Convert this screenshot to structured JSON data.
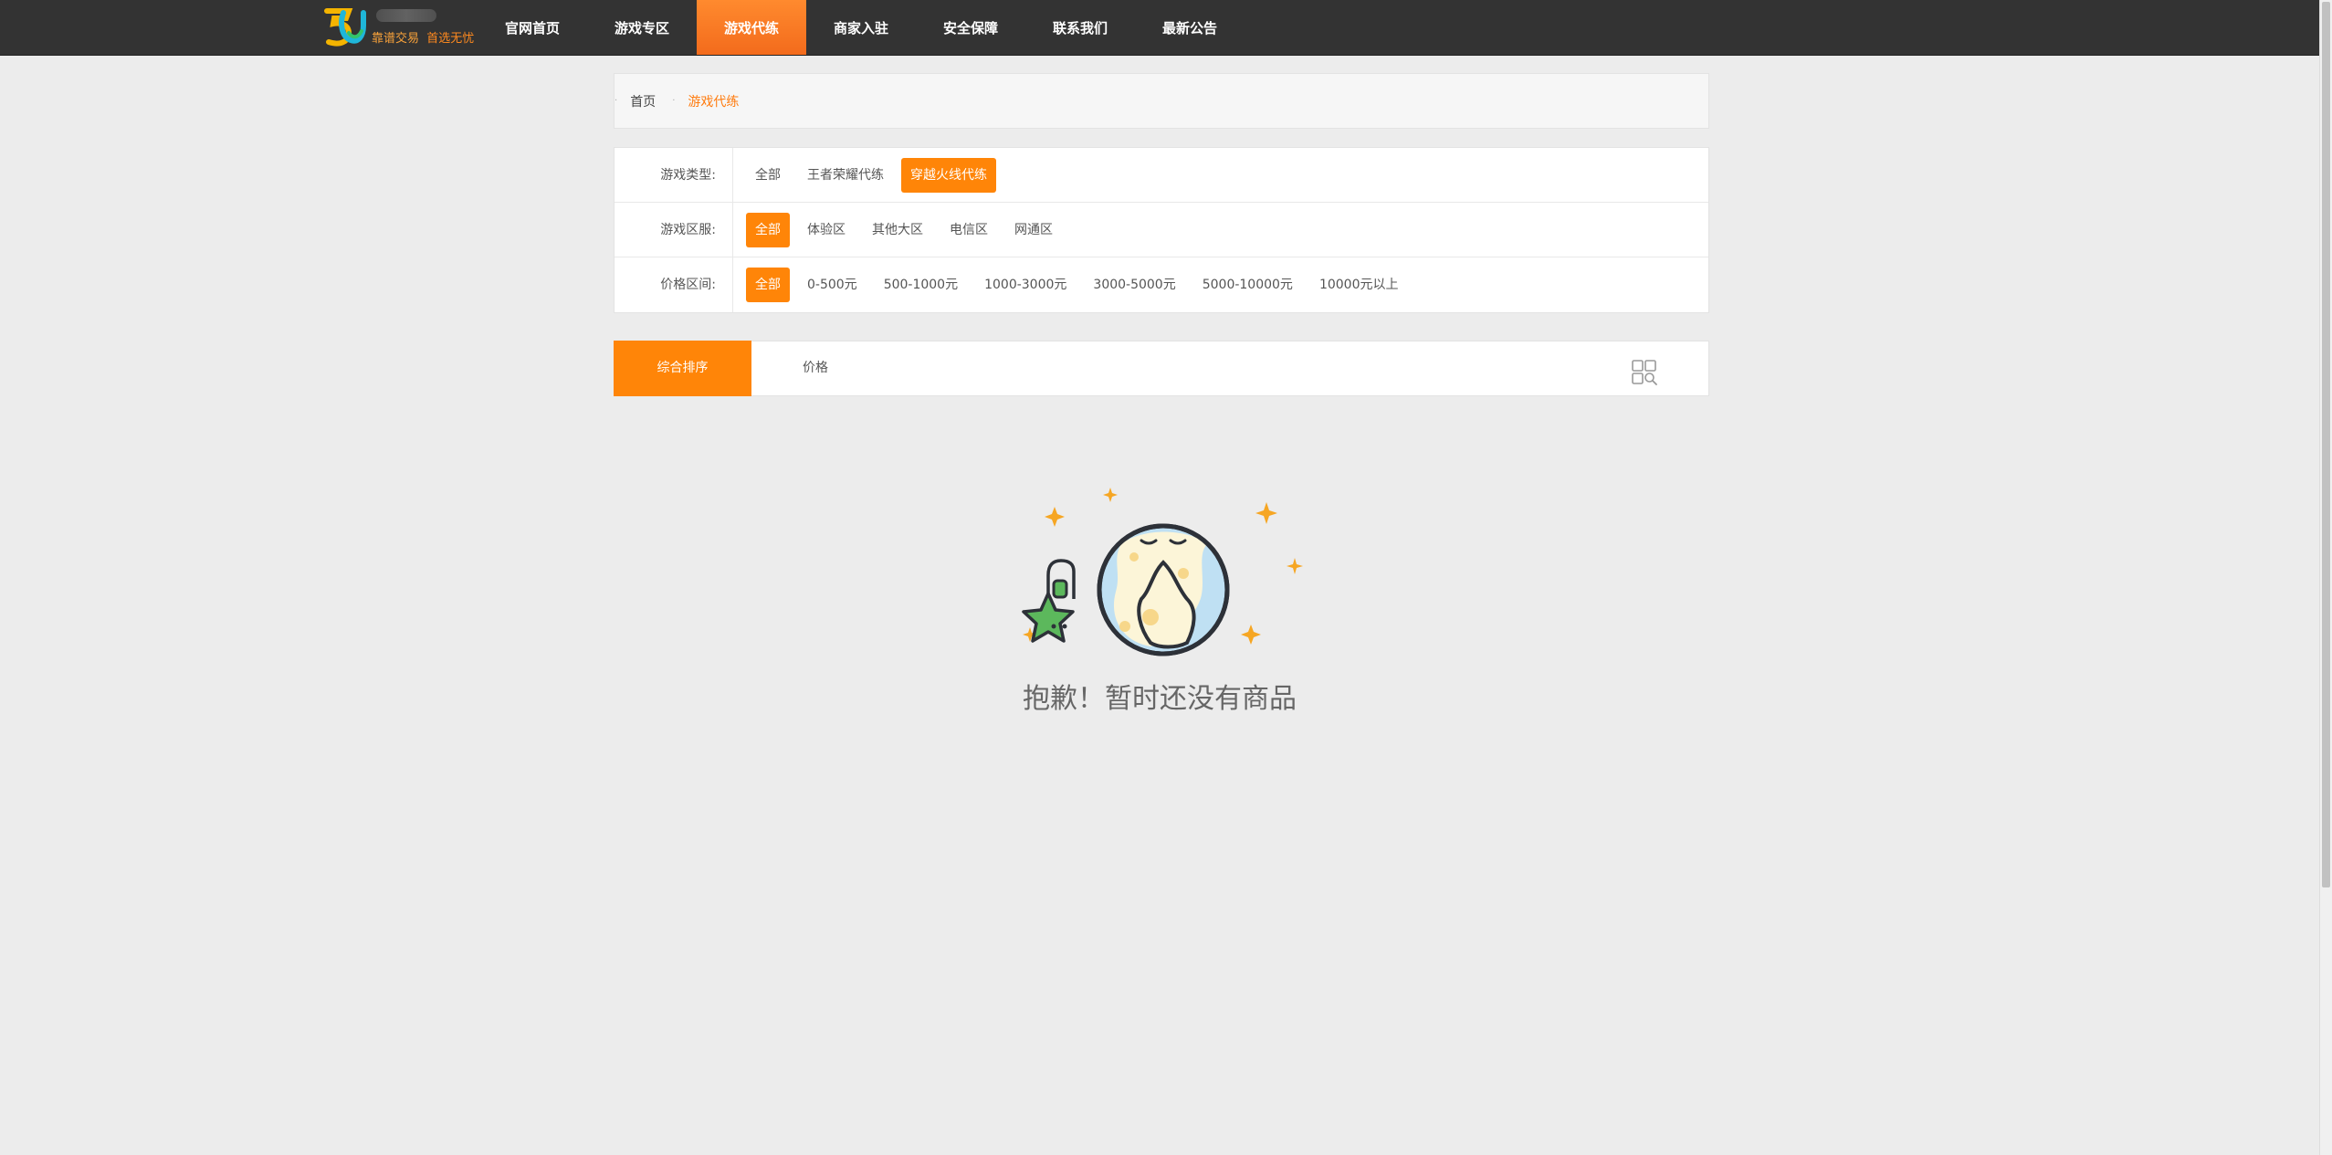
{
  "header": {
    "logo": {
      "digits": "5U",
      "slogan_a": "靠谱交易",
      "slogan_b": "首选无忧"
    },
    "nav": [
      {
        "label": "官网首页"
      },
      {
        "label": "游戏专区"
      },
      {
        "label": "游戏代练",
        "active": true
      },
      {
        "label": "商家入驻"
      },
      {
        "label": "安全保障"
      },
      {
        "label": "联系我们"
      },
      {
        "label": "最新公告"
      }
    ]
  },
  "breadcrumb": {
    "home": "首页",
    "current": "游戏代练"
  },
  "filters": {
    "game_type": {
      "label": "游戏类型:",
      "options": [
        "全部",
        "王者荣耀代练",
        "穿越火线代练"
      ],
      "selected": "穿越火线代练"
    },
    "server": {
      "label": "游戏区服:",
      "options": [
        "全部",
        "体验区",
        "其他大区",
        "电信区",
        "网通区"
      ],
      "selected": "全部"
    },
    "price": {
      "label": "价格区间:",
      "options": [
        "全部",
        "0-500元",
        "500-1000元",
        "1000-3000元",
        "3000-5000元",
        "5000-10000元",
        "10000元以上"
      ],
      "selected": "全部"
    }
  },
  "sort": {
    "tabs": [
      "综合排序",
      "价格"
    ],
    "active": "综合排序"
  },
  "empty": {
    "message": "抱歉！暂时还没有商品"
  },
  "colors": {
    "accent": "#ff8508",
    "nav_bg": "#333333",
    "page_bg": "#ececec"
  }
}
